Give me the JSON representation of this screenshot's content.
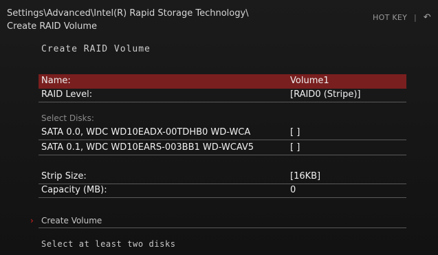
{
  "breadcrumb": {
    "line1": "Settings\\Advanced\\Intel(R) Rapid Storage Technology\\",
    "line2": "Create RAID Volume"
  },
  "hotkey": {
    "label": "HOT KEY",
    "separator": "|",
    "back_icon": "back-arrow-icon"
  },
  "page_title": "Create RAID Volume",
  "fields": {
    "name": {
      "label": "Name:",
      "value": "Volume1"
    },
    "raid_level": {
      "label": "RAID Level:",
      "value": "[RAID0 (Stripe)]"
    },
    "select_disks_label": "Select Disks:",
    "disks": [
      {
        "label": "SATA 0.0, WDC WD10EADX-00TDHB0 WD-WCA",
        "value": "[ ]"
      },
      {
        "label": "SATA 0.1, WDC WD10EARS-003BB1 WD-WCAV5",
        "value": "[ ]"
      }
    ],
    "strip_size": {
      "label": "Strip Size:",
      "value": "[16KB]"
    },
    "capacity": {
      "label": "Capacity (MB):",
      "value": "0"
    }
  },
  "action": {
    "label": "Create Volume",
    "indicator": "›"
  },
  "help_text": "Select at least two disks",
  "colors": {
    "selection": "#7a1f1f",
    "accent": "#dd2222",
    "background": "#141414"
  }
}
